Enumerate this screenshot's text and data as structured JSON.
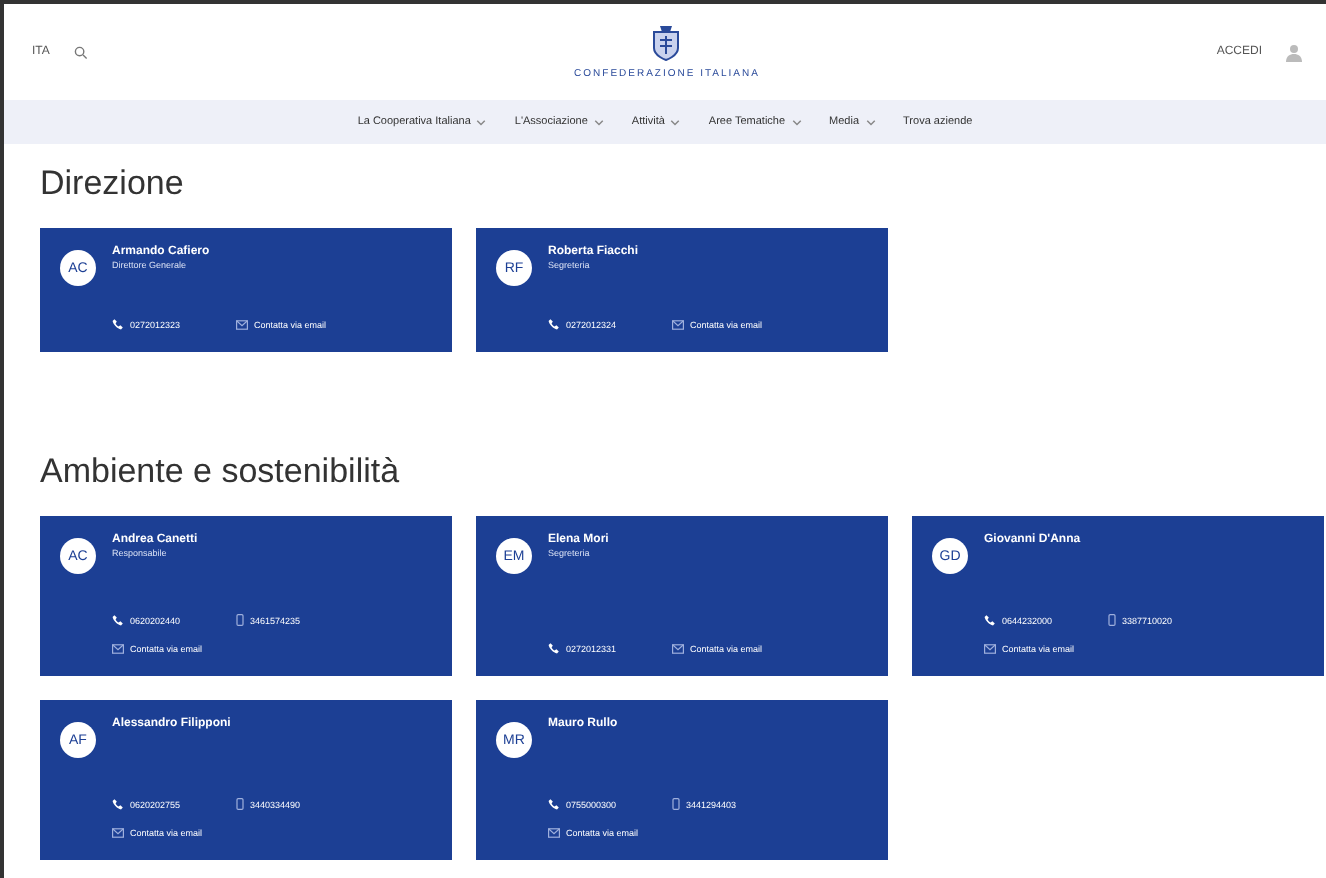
{
  "header": {
    "language": "ITA",
    "logo_text": "CONFEDERAZIONE ITALIANA",
    "login": "ACCEDI"
  },
  "nav": [
    {
      "label": "La Cooperativa Italiana",
      "has_menu": true
    },
    {
      "label": "L'Associazione",
      "has_menu": true
    },
    {
      "label": "Attività",
      "has_menu": true
    },
    {
      "label": "Aree Tematiche",
      "has_menu": true
    },
    {
      "label": "Media",
      "has_menu": true
    },
    {
      "label": "Trova aziende",
      "has_menu": false
    }
  ],
  "sections": [
    {
      "title": "Direzione",
      "people": [
        {
          "initials": "AC",
          "name": "Armando Cafiero",
          "role": "Direttore Generale",
          "contacts": [
            {
              "kind": "phone",
              "text": "0272012323"
            },
            {
              "kind": "email",
              "text": "Contatta via email"
            }
          ]
        },
        {
          "initials": "RF",
          "name": "Roberta Fiacchi",
          "role": "Segreteria",
          "contacts": [
            {
              "kind": "phone",
              "text": "0272012324"
            },
            {
              "kind": "email",
              "text": "Contatta via email"
            }
          ]
        }
      ]
    },
    {
      "title": "Ambiente e sostenibilità",
      "people": [
        {
          "initials": "AC",
          "name": "Andrea Canetti",
          "role": "Responsabile",
          "contacts": [
            {
              "kind": "phone",
              "text": "0620202440"
            },
            {
              "kind": "mobile",
              "text": "3461574235"
            },
            {
              "kind": "email",
              "text": "Contatta via email"
            }
          ]
        },
        {
          "initials": "EM",
          "name": "Elena Mori",
          "role": "Segreteria",
          "contacts": [
            {
              "kind": "phone",
              "text": "0272012331"
            },
            {
              "kind": "email",
              "text": "Contatta via email"
            }
          ]
        },
        {
          "initials": "GD",
          "name": "Giovanni D'Anna",
          "contacts": [
            {
              "kind": "phone",
              "text": "0644232000"
            },
            {
              "kind": "mobile",
              "text": "3387710020"
            },
            {
              "kind": "email",
              "text": "Contatta via email"
            }
          ]
        },
        {
          "initials": "AF",
          "name": "Alessandro Filipponi",
          "contacts": [
            {
              "kind": "phone",
              "text": "0620202755"
            },
            {
              "kind": "mobile",
              "text": "3440334490"
            },
            {
              "kind": "email",
              "text": "Contatta via email"
            }
          ]
        },
        {
          "initials": "MR",
          "name": "Mauro Rullo",
          "contacts": [
            {
              "kind": "phone",
              "text": "0755000300"
            },
            {
              "kind": "mobile",
              "text": "3441294403"
            },
            {
              "kind": "email",
              "text": "Contatta via email"
            }
          ]
        }
      ]
    }
  ]
}
